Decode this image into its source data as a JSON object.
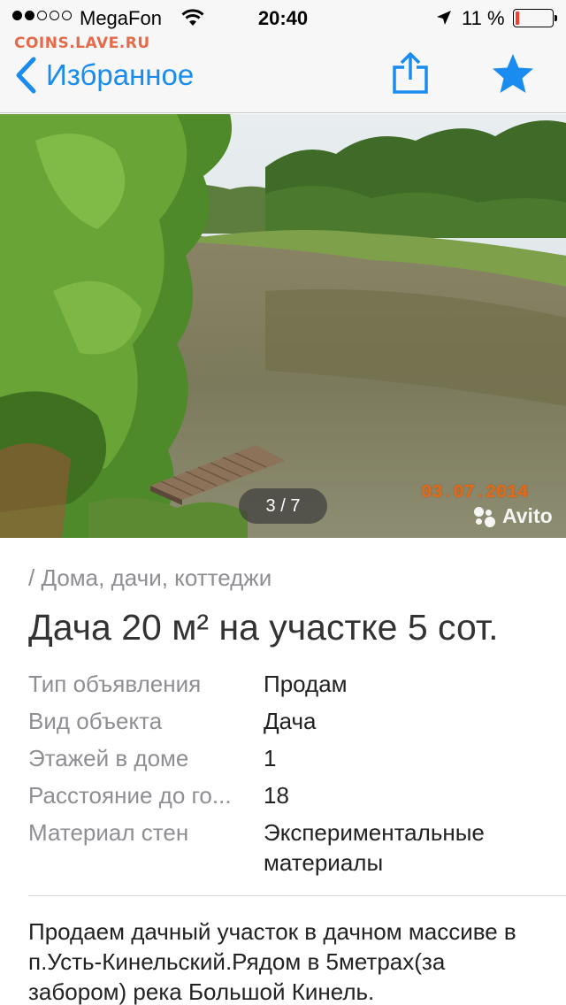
{
  "status_bar": {
    "signal_dots_filled": 2,
    "signal_dots_total": 5,
    "carrier": "MegaFon",
    "time": "20:40",
    "battery_percent": "11 %",
    "battery_level": 0.11,
    "battery_color": "#ff3b30"
  },
  "watermark": "COINS.LAVE.RU",
  "nav": {
    "back_label": "Избранное",
    "back_icon": "chevron-left-icon",
    "share_icon": "share-icon",
    "favorite_icon": "star-icon",
    "accent_color": "#1a8cf0"
  },
  "gallery": {
    "counter": "3 / 7",
    "photo_date_stamp": "03.07.2014",
    "brand_watermark": "Avito"
  },
  "listing": {
    "breadcrumb": "/ Дома, дачи, коттеджи",
    "title": "Дача 20 м² на участке 5 сот.",
    "properties": [
      {
        "key": "Тип объявления",
        "value": "Продам"
      },
      {
        "key": "Вид объекта",
        "value": "Дача"
      },
      {
        "key": "Этажей в доме",
        "value": "1"
      },
      {
        "key": "Расстояние до го...",
        "value": "18"
      },
      {
        "key": "Материал стен",
        "value": "Экспериментальные материалы"
      }
    ],
    "description": "Продаем дачный участок в дачном массиве в п.Усть-Кинельский.Рядом в 5метрах(за забором) река Большой Кинель."
  }
}
